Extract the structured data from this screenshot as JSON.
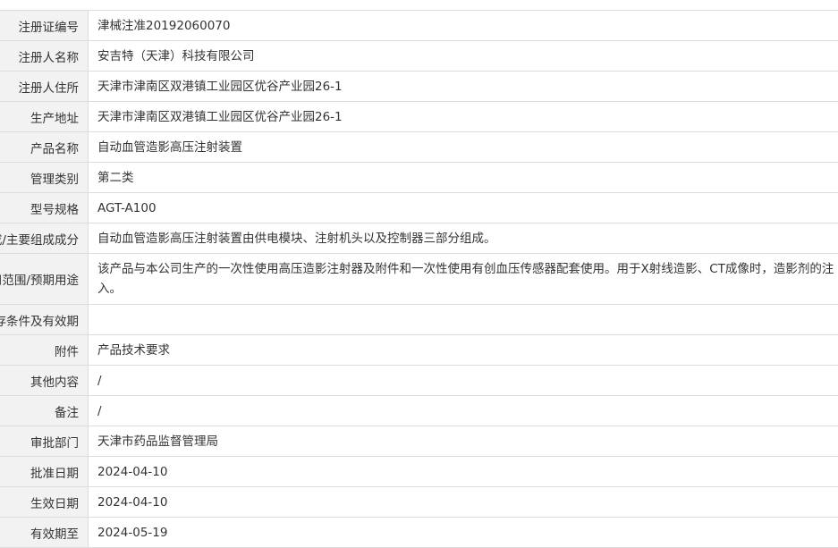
{
  "rows": [
    {
      "label": "注册证编号",
      "value": "津械注准20192060070"
    },
    {
      "label": "注册人名称",
      "value": "安吉特（天津）科技有限公司"
    },
    {
      "label": "注册人住所",
      "value": "天津市津南区双港镇工业园区优谷产业园26-1"
    },
    {
      "label": "生产地址",
      "value": "天津市津南区双港镇工业园区优谷产业园26-1"
    },
    {
      "label": "产品名称",
      "value": "自动血管造影高压注射装置"
    },
    {
      "label": "管理类别",
      "value": "第二类"
    },
    {
      "label": "型号规格",
      "value": "AGT-A100"
    },
    {
      "label": "结构及组成/主要组成成分",
      "value": "自动血管造影高压注射装置由供电模块、注射机头以及控制器三部分组成。"
    },
    {
      "label": "适用范围/预期用途",
      "value": "该产品与本公司生产的一次性使用高压造影注射器及附件和一次性使用有创血压传感器配套使用。用于X射线造影、CT成像时，造影剂的注入。"
    },
    {
      "label": "产品储存条件及有效期",
      "value": ""
    },
    {
      "label": "附件",
      "value": "产品技术要求"
    },
    {
      "label": "其他内容",
      "value": "/"
    },
    {
      "label": "备注",
      "value": "/"
    },
    {
      "label": "审批部门",
      "value": "天津市药品监督管理局"
    },
    {
      "label": "批准日期",
      "value": "2024-04-10"
    },
    {
      "label": "生效日期",
      "value": "2024-04-10"
    },
    {
      "label": "有效期至",
      "value": "2024-05-19"
    }
  ]
}
